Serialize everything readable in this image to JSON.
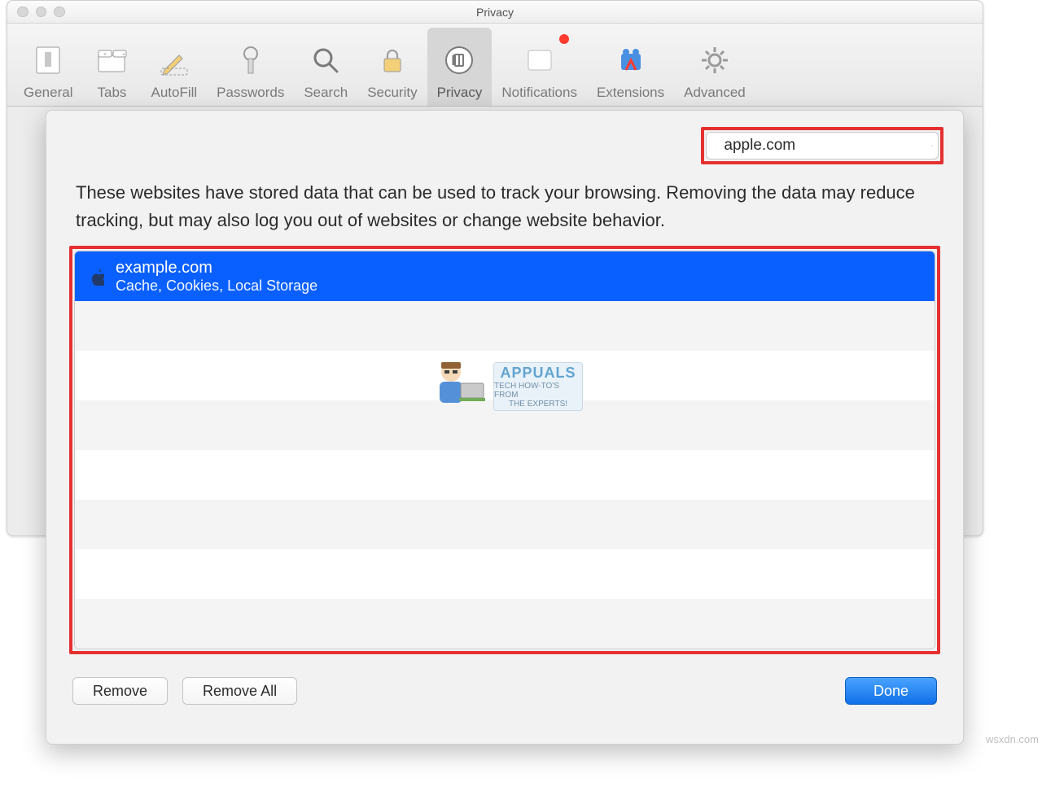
{
  "window": {
    "title": "Privacy"
  },
  "toolbar": {
    "selected": "Privacy",
    "items": [
      {
        "id": "general",
        "label": "General"
      },
      {
        "id": "tabs",
        "label": "Tabs"
      },
      {
        "id": "autofill",
        "label": "AutoFill"
      },
      {
        "id": "passwords",
        "label": "Passwords"
      },
      {
        "id": "search",
        "label": "Search"
      },
      {
        "id": "security",
        "label": "Security"
      },
      {
        "id": "privacy",
        "label": "Privacy"
      },
      {
        "id": "notifications",
        "label": "Notifications",
        "badge": true
      },
      {
        "id": "extensions",
        "label": "Extensions"
      },
      {
        "id": "advanced",
        "label": "Advanced"
      }
    ]
  },
  "sheet": {
    "search_value": "apple.com",
    "description": "These websites have stored data that can be used to track your browsing. Removing the data may reduce tracking, but may also log you out of websites or change website behavior.",
    "sites": [
      {
        "domain": "example.com",
        "data_types": "Cache, Cookies, Local Storage",
        "favicon": "apple-icon",
        "selected": true
      }
    ],
    "remove_label": "Remove",
    "remove_all_label": "Remove All",
    "done_label": "Done"
  },
  "watermark": {
    "brand": "APPUALS",
    "tagline1": "TECH HOW-TO'S FROM",
    "tagline2": "THE EXPERTS!"
  },
  "source_credit": "wsxdn.com"
}
